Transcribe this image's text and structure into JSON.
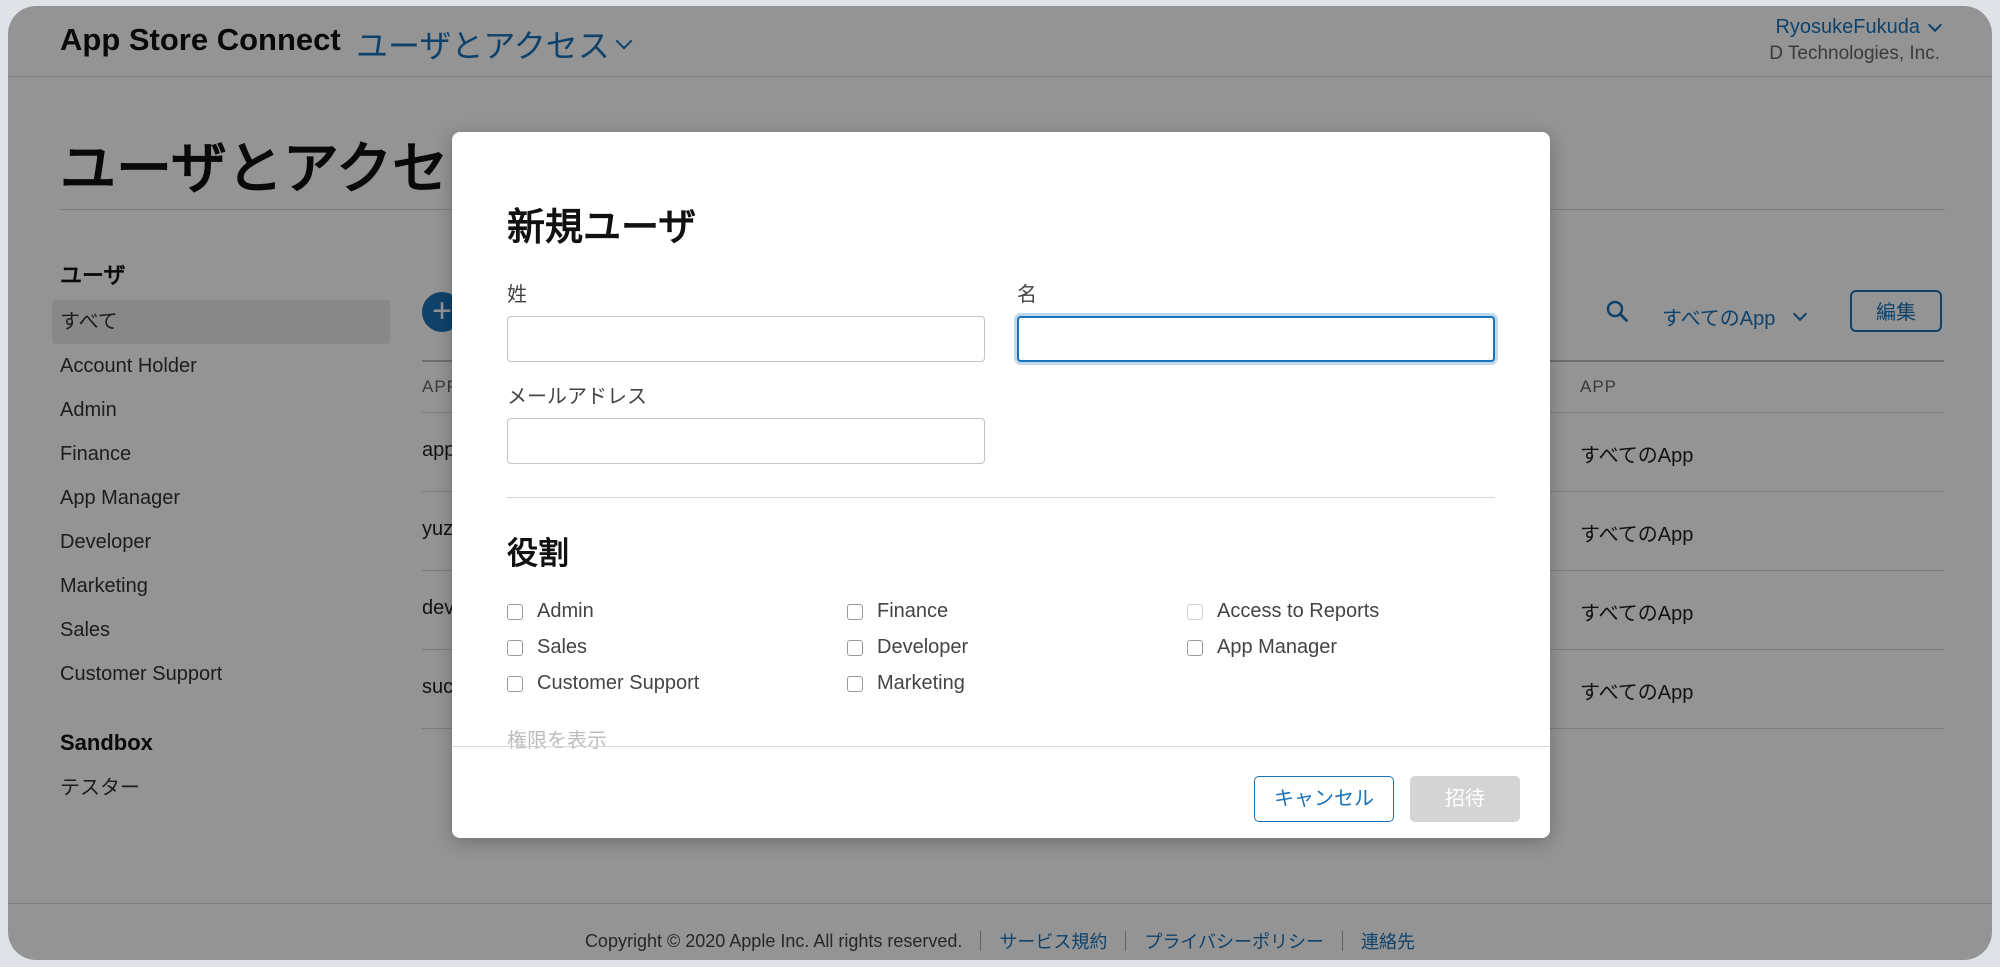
{
  "header": {
    "brand": "App Store Connect",
    "section": "ユーザとアクセス",
    "user_name": "RyosukeFukuda",
    "org": "D Technologies, Inc."
  },
  "page": {
    "title": "ユーザとアクセス"
  },
  "sidebar": {
    "users_heading": "ユーザ",
    "items": [
      "すべて",
      "Account Holder",
      "Admin",
      "Finance",
      "App Manager",
      "Developer",
      "Marketing",
      "Sales",
      "Customer Support"
    ],
    "active_index": 0,
    "sandbox_heading": "Sandbox",
    "sandbox_items": [
      "テスター"
    ]
  },
  "toolbar": {
    "filter_label": "すべてのApp",
    "edit_label": "編集"
  },
  "table": {
    "col_first": "APP",
    "col_app": "APP",
    "rows": [
      {
        "user": "app",
        "app": "すべてのApp"
      },
      {
        "user": "yuz",
        "app": "すべてのApp"
      },
      {
        "user": "dev",
        "app": "すべてのApp"
      },
      {
        "user": "suc",
        "app": "すべてのApp"
      }
    ]
  },
  "footer": {
    "copyright": "Copyright © 2020 Apple Inc. All rights reserved.",
    "terms": "サービス規約",
    "privacy": "プライバシーポリシー",
    "contact": "連絡先"
  },
  "modal": {
    "title": "新規ユーザ",
    "last_name_label": "姓",
    "first_name_label": "名",
    "email_label": "メールアドレス",
    "last_name_value": "",
    "first_name_value": "",
    "email_value": "",
    "roles_title": "役割",
    "roles": [
      [
        "Admin",
        "Sales",
        "Customer Support"
      ],
      [
        "Finance",
        "Developer",
        "Marketing"
      ],
      [
        "Access to Reports",
        "App Manager"
      ]
    ],
    "show_permissions": "権限を表示",
    "cancel_label": "キャンセル",
    "invite_label": "招待"
  },
  "colors": {
    "accent": "#1a73b8",
    "overlay": "rgba(0,0,0,0.42)",
    "disabled_button": "#d4d4d4"
  }
}
